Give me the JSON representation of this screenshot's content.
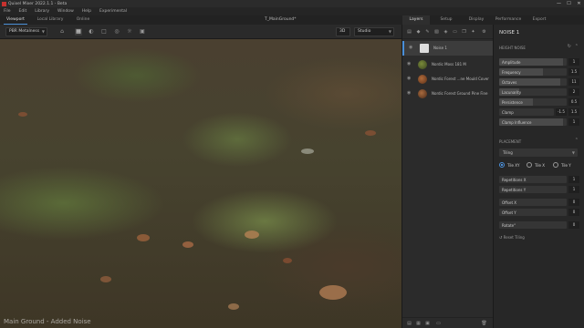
{
  "window": {
    "app_title": "Quixel Mixer 2022.1.1 - Beta",
    "minimize": "—",
    "maximize": "☐",
    "close": "✕"
  },
  "menu": [
    "File",
    "Edit",
    "Library",
    "Window",
    "Help",
    "Experimental"
  ],
  "viewport_tabs": [
    "Viewport",
    "Local Library",
    "Online"
  ],
  "document_title": "T_MainGround*",
  "right_tabs": [
    "Layers",
    "Setup",
    "Display",
    "Performance",
    "Export"
  ],
  "toolbar": {
    "render_mode": "PBR Metalness",
    "view_mode": "3D",
    "lighting": "Studio"
  },
  "viewport": {
    "status_text": "Main Ground - Added Noise"
  },
  "layers": [
    {
      "name": "Noise 1",
      "selected": true
    },
    {
      "name": "Nordic Moss 181 M",
      "selected": false
    },
    {
      "name": "Nordic Forest ...ne Mould Cover",
      "selected": false
    },
    {
      "name": "Nordic Forest Ground Pine Fine",
      "selected": false
    }
  ],
  "properties": {
    "title": "NOISE 1",
    "height_noise": {
      "header": "HEIGHT NOISE",
      "params": [
        {
          "label": "Amplitude",
          "value": "1",
          "fill": 0.95
        },
        {
          "label": "Frequency",
          "value": "1.5",
          "fill": 0.65
        },
        {
          "label": "Octaves",
          "value": "11",
          "fill": 0.9
        },
        {
          "label": "Lacunarity",
          "value": "2",
          "fill": 0.3
        },
        {
          "label": "Persistence",
          "value": "0.5",
          "fill": 0.5
        },
        {
          "label": "Clamp",
          "value_min": "-1.5",
          "value": "1.5",
          "fill": 0.0
        },
        {
          "label": "Clamp Influence",
          "value": "1",
          "fill": 0.95
        }
      ]
    },
    "placement": {
      "header": "PLACEMENT",
      "mode": "Tiling",
      "tile_options": [
        "Tile XY",
        "Tile X",
        "Tile Y"
      ],
      "tile_selected": "Tile XY",
      "params": [
        {
          "label": "Repetitions X",
          "value": "1"
        },
        {
          "label": "Repetitions Y",
          "value": "1"
        },
        {
          "label": "Offset X",
          "value": "0"
        },
        {
          "label": "Offset Y",
          "value": "0"
        },
        {
          "label": "Rotate°",
          "value": "0"
        }
      ],
      "reset_label": "Reset Tiling"
    }
  },
  "colors": {
    "accent": "#4a8fd8",
    "panel_bg": "#2b2b2b",
    "brand": "#c8322f"
  }
}
